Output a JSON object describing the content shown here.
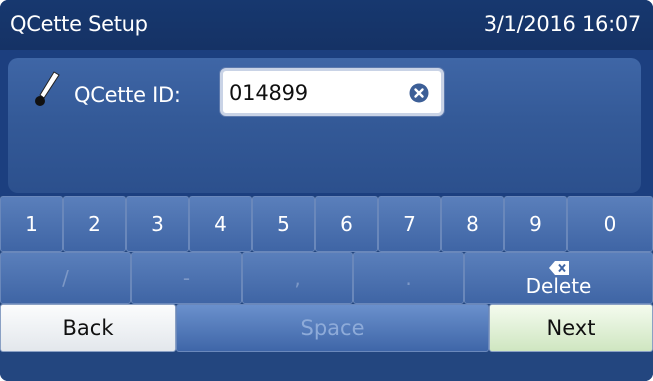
{
  "header": {
    "title": "QCette Setup",
    "datetime": "3/1/2016 16:07"
  },
  "form": {
    "icon": "pipette-icon",
    "label": "QCette ID:",
    "value": "014899",
    "clear_icon": "clear-circle-icon"
  },
  "keyboard": {
    "digits": [
      "1",
      "2",
      "3",
      "4",
      "5",
      "6",
      "7",
      "8",
      "9",
      "0"
    ],
    "symbols": [
      "/",
      "-",
      ",",
      "."
    ],
    "delete_label": "Delete",
    "delete_icon": "backspace-icon",
    "back_label": "Back",
    "space_label": "Space",
    "next_label": "Next"
  },
  "colors": {
    "background": "#1c3f7f",
    "key": "#4a70b0",
    "next_button": "#d9eccd",
    "back_button": "#eef0f3"
  }
}
